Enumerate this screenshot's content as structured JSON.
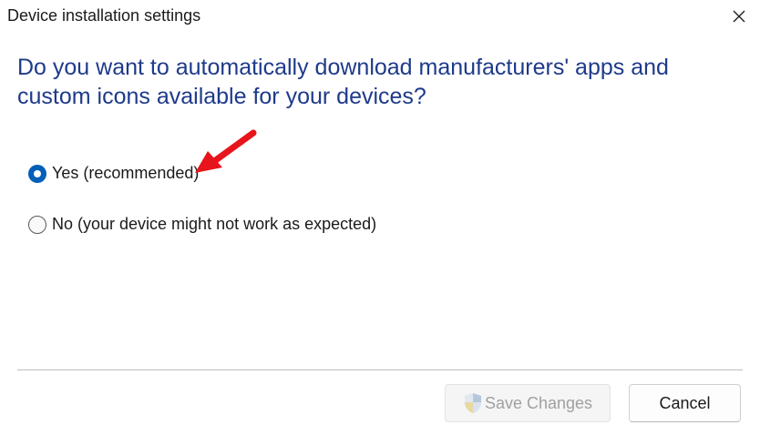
{
  "window": {
    "title": "Device installation settings"
  },
  "question": "Do you want to automatically download manufacturers' apps and custom icons available for your devices?",
  "options": [
    {
      "label": "Yes (recommended)",
      "selected": true
    },
    {
      "label": "No (your device might not work as expected)",
      "selected": false
    }
  ],
  "buttons": {
    "save_label": "Save Changes",
    "save_enabled": false,
    "cancel_label": "Cancel"
  },
  "icons": {
    "close": "close-icon",
    "shield": "uac-shield-icon",
    "annotation": "red-arrow-icon"
  },
  "colors": {
    "accent": "#005fb8",
    "question_text": "#1e3a8a",
    "annotation_arrow": "#e8141b"
  }
}
